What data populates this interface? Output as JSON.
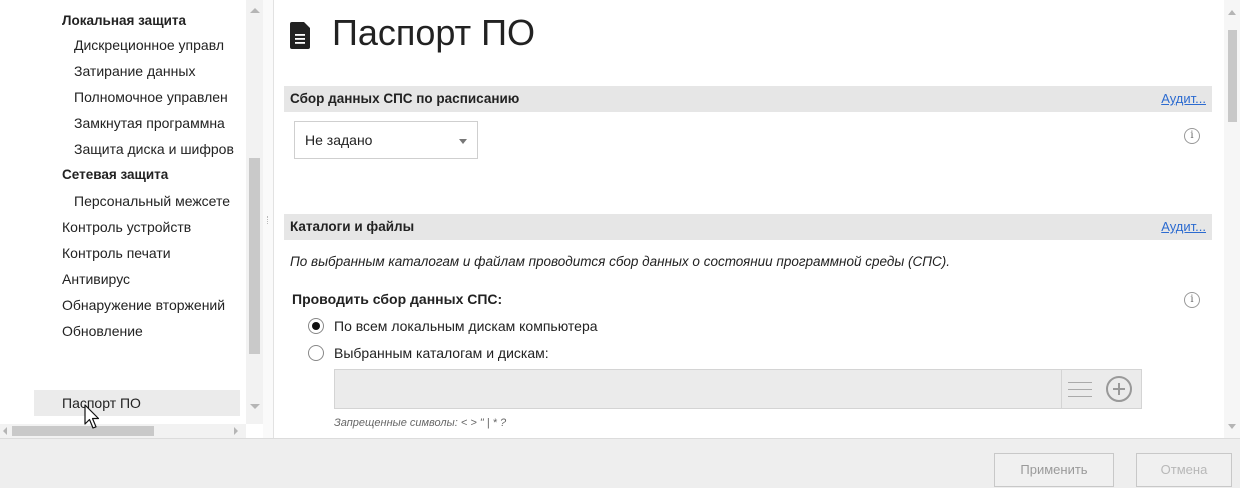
{
  "nav": {
    "items": [
      {
        "label": "Локальная защита",
        "level": 1,
        "bold": true
      },
      {
        "label": "Дискреционное управл",
        "level": 2,
        "bold": false
      },
      {
        "label": "Затирание данных",
        "level": 2,
        "bold": false
      },
      {
        "label": "Полномочное управлен",
        "level": 2,
        "bold": false
      },
      {
        "label": "Замкнутая программна",
        "level": 2,
        "bold": false
      },
      {
        "label": "Защита диска и шифров",
        "level": 2,
        "bold": false
      },
      {
        "label": "Сетевая защита",
        "level": 1,
        "bold": true
      },
      {
        "label": "Персональный межсете",
        "level": 2,
        "bold": false
      },
      {
        "label": "Контроль устройств",
        "level": 0,
        "bold": false
      },
      {
        "label": "Контроль печати",
        "level": 0,
        "bold": false
      },
      {
        "label": "Антивирус",
        "level": 0,
        "bold": false
      },
      {
        "label": "Обнаружение вторжений",
        "level": 0,
        "bold": false
      },
      {
        "label": "Обновление",
        "level": 0,
        "bold": false
      },
      {
        "label": "Паспорт ПО",
        "level": 0,
        "bold": false,
        "selected": true
      }
    ]
  },
  "page": {
    "title": "Паспорт ПО",
    "icon": "document-icon"
  },
  "schedule_section": {
    "title": "Сбор данных СПС по расписанию",
    "audit_link": "Аудит...",
    "select_value": "Не задано"
  },
  "files_section": {
    "title": "Каталоги и файлы",
    "audit_link": "Аудит...",
    "description": "По выбранным каталогам и файлам проводится сбор данных о состоянии программной среды (СПС).",
    "collect_label": "Проводить сбор данных СПС:",
    "radio_options": [
      {
        "label": "По всем локальным дискам компьютера",
        "checked": true
      },
      {
        "label": "Выбранным каталогам и дискам:",
        "checked": false
      }
    ],
    "path_value": "",
    "forbidden_hint": "Запрещенные символы: < > \" | * ?"
  },
  "footer": {
    "apply_label": "Применить",
    "cancel_label": "Отмена"
  },
  "colors": {
    "link": "#2c6bd0",
    "section_header_bg": "#e6e6e6",
    "selected_bg": "#ebebeb"
  }
}
